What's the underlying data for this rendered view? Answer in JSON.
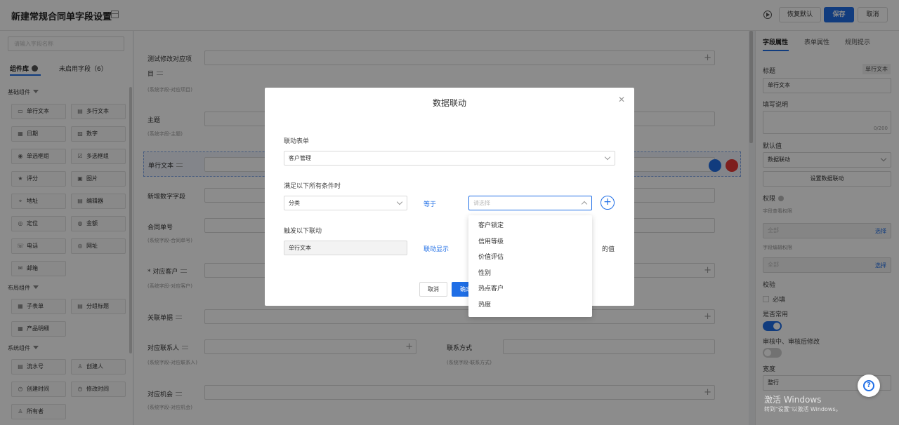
{
  "header": {
    "title": "新建常规合同单字段设置",
    "restore_label": "恢复默认",
    "save_label": "保存",
    "cancel_label": "取消"
  },
  "left_panel": {
    "search_placeholder": "请输入字段名称",
    "tab_library": "组件库",
    "tab_unused": "未启用字段（6）",
    "groups": {
      "basic": "基础组件",
      "layout": "布局组件",
      "system": "系统组件"
    },
    "basic_components": [
      {
        "label": "单行文本",
        "icon": "single-line-text-icon",
        "glyph": "▭"
      },
      {
        "label": "多行文本",
        "icon": "multi-line-text-icon",
        "glyph": "▤"
      },
      {
        "label": "日期",
        "icon": "date-icon",
        "glyph": "▦"
      },
      {
        "label": "数字",
        "icon": "number-icon",
        "glyph": "▨"
      },
      {
        "label": "单选框组",
        "icon": "radio-group-icon",
        "glyph": "◉"
      },
      {
        "label": "多选框组",
        "icon": "checkbox-group-icon",
        "glyph": "☑"
      },
      {
        "label": "评分",
        "icon": "star-icon",
        "glyph": "★"
      },
      {
        "label": "图片",
        "icon": "image-icon",
        "glyph": "▣"
      },
      {
        "label": "地址",
        "icon": "location-pin-icon",
        "glyph": "⌖"
      },
      {
        "label": "编辑器",
        "icon": "editor-icon",
        "glyph": "▤"
      },
      {
        "label": "定位",
        "icon": "locate-icon",
        "glyph": "◎"
      },
      {
        "label": "金额",
        "icon": "amount-icon",
        "glyph": "◍"
      },
      {
        "label": "电话",
        "icon": "phone-icon",
        "glyph": "☏"
      },
      {
        "label": "网址",
        "icon": "url-icon",
        "glyph": "◎"
      },
      {
        "label": "邮箱",
        "icon": "mail-icon",
        "glyph": "✉"
      }
    ],
    "layout_components": [
      {
        "label": "子表单",
        "icon": "subform-icon",
        "glyph": "▦"
      },
      {
        "label": "分组标题",
        "icon": "group-title-icon",
        "glyph": "▤"
      },
      {
        "label": "产品明细",
        "icon": "product-detail-icon",
        "glyph": "▦"
      }
    ],
    "system_components": [
      {
        "label": "流水号",
        "icon": "serial-number-icon",
        "glyph": "▤"
      },
      {
        "label": "创建人",
        "icon": "creator-icon",
        "glyph": "♙"
      },
      {
        "label": "创建时间",
        "icon": "create-time-icon",
        "glyph": "◷"
      },
      {
        "label": "修改时间",
        "icon": "modify-time-icon",
        "glyph": "◷"
      },
      {
        "label": "所有者",
        "icon": "owner-icon",
        "glyph": "♙"
      }
    ]
  },
  "canvas": {
    "fields": {
      "test_item_a": "测试修改对应项",
      "test_item_b": "目",
      "test_item_sub": "(系统字段-对应项目)",
      "subject": "主题",
      "subject_sub": "(系统字段-主题)",
      "single_text": "单行文本",
      "new_number": "新增数字字段",
      "contract_no": "合同单号",
      "contract_no_sub": "(系统字段-合同单号)",
      "customer": "* 对应客户",
      "customer_sub": "(系统字段-对应客户)",
      "related_doc": "关联单据",
      "contact": "对应联系人",
      "contact_sub": "(系统字段-对应联系人)",
      "contact_method": "联系方式",
      "contact_method_sub": "(系统字段-联系方式)",
      "opportunity": "对应机会",
      "opportunity_sub": "(系统字段-对应机会)"
    }
  },
  "right_panel": {
    "tab_field": "字段属性",
    "tab_form": "表单属性",
    "tab_rule": "规则提示",
    "title_label": "标题",
    "title_type": "单行文本",
    "title_value": "单行文本",
    "desc_label": "填写说明",
    "desc_counter": "0/200",
    "default_label": "默认值",
    "default_value": "数据联动",
    "set_link_button": "设置数据联动",
    "permission_label": "权限",
    "view_perm_label": "字段查看权限",
    "view_perm_value": "全部",
    "view_perm_link": "选择",
    "edit_perm_label": "字段编辑权限",
    "edit_perm_value": "全部",
    "edit_perm_link": "选择",
    "validate_label": "校验",
    "required_label": "必填",
    "common_label": "是否常用",
    "common_on": true,
    "review_label": "审核中、审核后修改",
    "review_on": false,
    "width_label": "宽度",
    "width_value": "整行",
    "watermark_title": "激活 Windows",
    "watermark_sub": "转到\"设置\"以激活 Windows。"
  },
  "modal": {
    "title": "数据联动",
    "link_form_label": "联动表单",
    "link_form_value": "客户管理",
    "conditions_label": "满足以下所有条件时",
    "cond_field": "分类",
    "cond_operator": "等于",
    "cond_value_placeholder": "请选择",
    "trigger_label": "触发以下联动",
    "trigger_field": "单行文本",
    "trigger_action": "联动显示",
    "trigger_value_suffix": "的值",
    "cancel_label": "取消",
    "ok_label": "确定",
    "dropdown_options": [
      "客户锁定",
      "信用等级",
      "价值评估",
      "性别",
      "热点客户",
      "热度"
    ]
  },
  "colors": {
    "primary": "#1f6ee6",
    "danger": "#e53935",
    "overlay": "rgba(0,0,0,0.45)"
  }
}
